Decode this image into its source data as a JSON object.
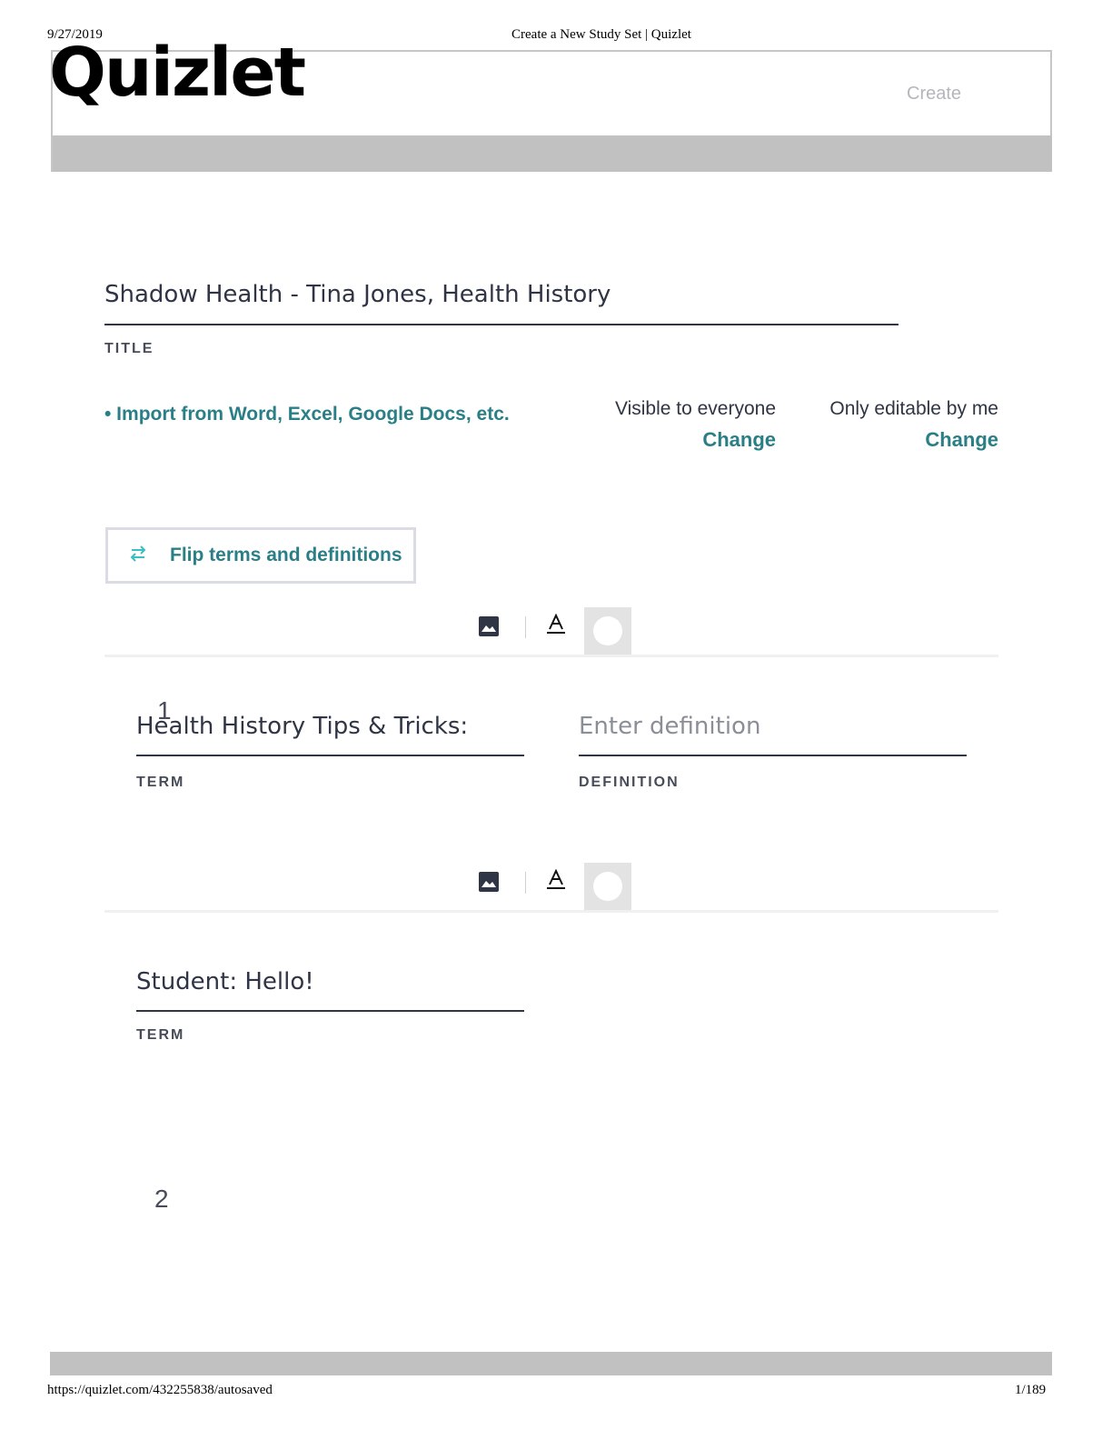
{
  "print_header": {
    "date": "9/27/2019",
    "page_title": "Create a New Study Set | Quizlet"
  },
  "header": {
    "logo": "Quizlet",
    "create_label": "Create"
  },
  "set": {
    "title_value": "Shadow Health - Tina Jones, Health History",
    "title_caption": "TITLE",
    "import_label": "• Import from Word, Excel, Google Docs, etc.",
    "visibility": {
      "label": "Visible to everyone",
      "change": "Change"
    },
    "editability": {
      "label": "Only editable by me",
      "change": "Change"
    },
    "flip_label": "Flip terms and definitions"
  },
  "toolbar": {
    "image_icon": "image-icon",
    "text_format_icon": "text-format-icon",
    "audio_icon": "audio-icon"
  },
  "cards": [
    {
      "number": "1",
      "term": "Health History Tips & Tricks:",
      "term_caption": "TERM",
      "definition_placeholder": "Enter definition",
      "definition_caption": "DEFINITION"
    },
    {
      "number": "2",
      "term": "Student: Hello!",
      "term_caption": "TERM"
    }
  ],
  "print_footer": {
    "url": "https://quizlet.com/432255838/autosaved",
    "page": "1/189"
  }
}
